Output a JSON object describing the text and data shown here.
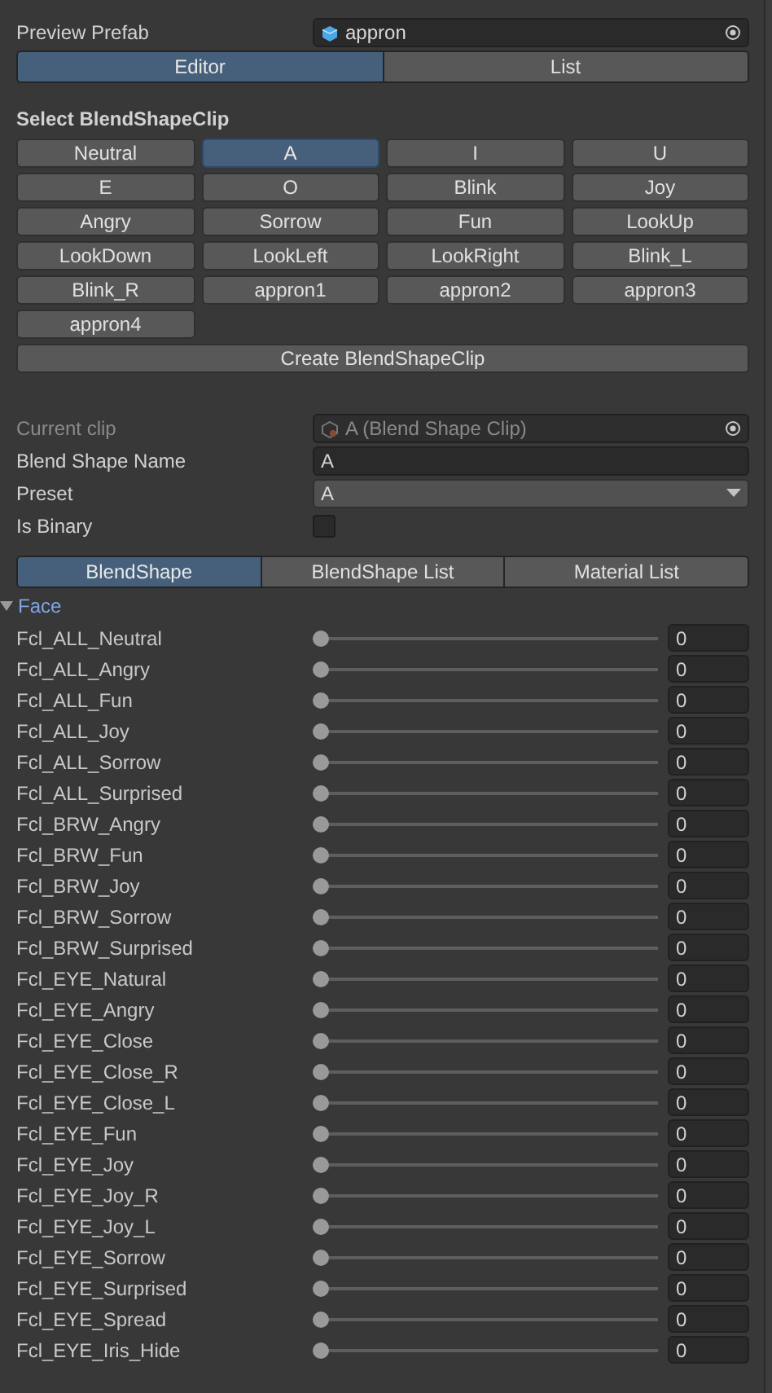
{
  "preview_prefab": {
    "label": "Preview Prefab",
    "value": "appron"
  },
  "mode_tabs": [
    {
      "label": "Editor",
      "selected": true
    },
    {
      "label": "List",
      "selected": false
    }
  ],
  "select_clip": {
    "heading": "Select BlendShapeClip",
    "clips": [
      {
        "label": "Neutral",
        "selected": false
      },
      {
        "label": "A",
        "selected": true
      },
      {
        "label": "I",
        "selected": false
      },
      {
        "label": "U",
        "selected": false
      },
      {
        "label": "E",
        "selected": false
      },
      {
        "label": "O",
        "selected": false
      },
      {
        "label": "Blink",
        "selected": false
      },
      {
        "label": "Joy",
        "selected": false
      },
      {
        "label": "Angry",
        "selected": false
      },
      {
        "label": "Sorrow",
        "selected": false
      },
      {
        "label": "Fun",
        "selected": false
      },
      {
        "label": "LookUp",
        "selected": false
      },
      {
        "label": "LookDown",
        "selected": false
      },
      {
        "label": "LookLeft",
        "selected": false
      },
      {
        "label": "LookRight",
        "selected": false
      },
      {
        "label": "Blink_L",
        "selected": false
      },
      {
        "label": "Blink_R",
        "selected": false
      },
      {
        "label": "appron1",
        "selected": false
      },
      {
        "label": "appron2",
        "selected": false
      },
      {
        "label": "appron3",
        "selected": false
      },
      {
        "label": "appron4",
        "selected": false
      }
    ],
    "create_button": "Create BlendShapeClip"
  },
  "properties": [
    {
      "kind": "object",
      "label": "Current clip",
      "value": "A (Blend Shape Clip)",
      "disabled": true
    },
    {
      "kind": "text",
      "label": "Blend Shape Name",
      "value": "A",
      "disabled": false
    },
    {
      "kind": "dropdown",
      "label": "Preset",
      "value": "A",
      "disabled": false
    },
    {
      "kind": "checkbox",
      "label": "Is Binary",
      "checked": false,
      "disabled": false
    }
  ],
  "section_tabs": [
    {
      "label": "BlendShape",
      "selected": true
    },
    {
      "label": "BlendShape List",
      "selected": false
    },
    {
      "label": "Material List",
      "selected": false
    }
  ],
  "foldout": {
    "label": "Face",
    "expanded": true
  },
  "blend_shapes": [
    {
      "name": "Fcl_ALL_Neutral",
      "level": 0,
      "value": "0"
    },
    {
      "name": "Fcl_ALL_Angry",
      "level": 0,
      "value": "0"
    },
    {
      "name": "Fcl_ALL_Fun",
      "level": 0,
      "value": "0"
    },
    {
      "name": "Fcl_ALL_Joy",
      "level": 0,
      "value": "0"
    },
    {
      "name": "Fcl_ALL_Sorrow",
      "level": 0,
      "value": "0"
    },
    {
      "name": "Fcl_ALL_Surprised",
      "level": 0,
      "value": "0"
    },
    {
      "name": "Fcl_BRW_Angry",
      "level": 0,
      "value": "0"
    },
    {
      "name": "Fcl_BRW_Fun",
      "level": 0,
      "value": "0"
    },
    {
      "name": "Fcl_BRW_Joy",
      "level": 0,
      "value": "0"
    },
    {
      "name": "Fcl_BRW_Sorrow",
      "level": 0,
      "value": "0"
    },
    {
      "name": "Fcl_BRW_Surprised",
      "level": 0,
      "value": "0"
    },
    {
      "name": "Fcl_EYE_Natural",
      "level": 0,
      "value": "0"
    },
    {
      "name": "Fcl_EYE_Angry",
      "level": 0,
      "value": "0"
    },
    {
      "name": "Fcl_EYE_Close",
      "level": 0,
      "value": "0"
    },
    {
      "name": "Fcl_EYE_Close_R",
      "level": 0,
      "value": "0"
    },
    {
      "name": "Fcl_EYE_Close_L",
      "level": 0,
      "value": "0"
    },
    {
      "name": "Fcl_EYE_Fun",
      "level": 0,
      "value": "0"
    },
    {
      "name": "Fcl_EYE_Joy",
      "level": 0,
      "value": "0"
    },
    {
      "name": "Fcl_EYE_Joy_R",
      "level": 0,
      "value": "0"
    },
    {
      "name": "Fcl_EYE_Joy_L",
      "level": 0,
      "value": "0"
    },
    {
      "name": "Fcl_EYE_Sorrow",
      "level": 0,
      "value": "0"
    },
    {
      "name": "Fcl_EYE_Surprised",
      "level": 0,
      "value": "0"
    },
    {
      "name": "Fcl_EYE_Spread",
      "level": 0,
      "value": "0"
    },
    {
      "name": "Fcl_EYE_Iris_Hide",
      "level": 0,
      "value": "0"
    }
  ]
}
